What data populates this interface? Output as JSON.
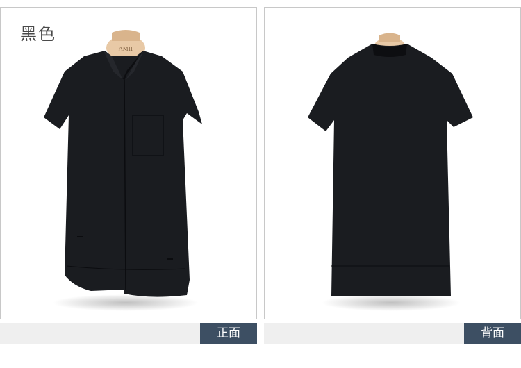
{
  "color_title": "黑色",
  "hanger_text": "AMII",
  "views": [
    {
      "id": "front",
      "label": "正面"
    },
    {
      "id": "back",
      "label": "背面"
    }
  ],
  "colors": {
    "garment": "#1a1c20",
    "hanger": "#e8c9a6",
    "tab": "#3d4f63",
    "bar": "#efefef",
    "border": "#c8c8c8"
  }
}
